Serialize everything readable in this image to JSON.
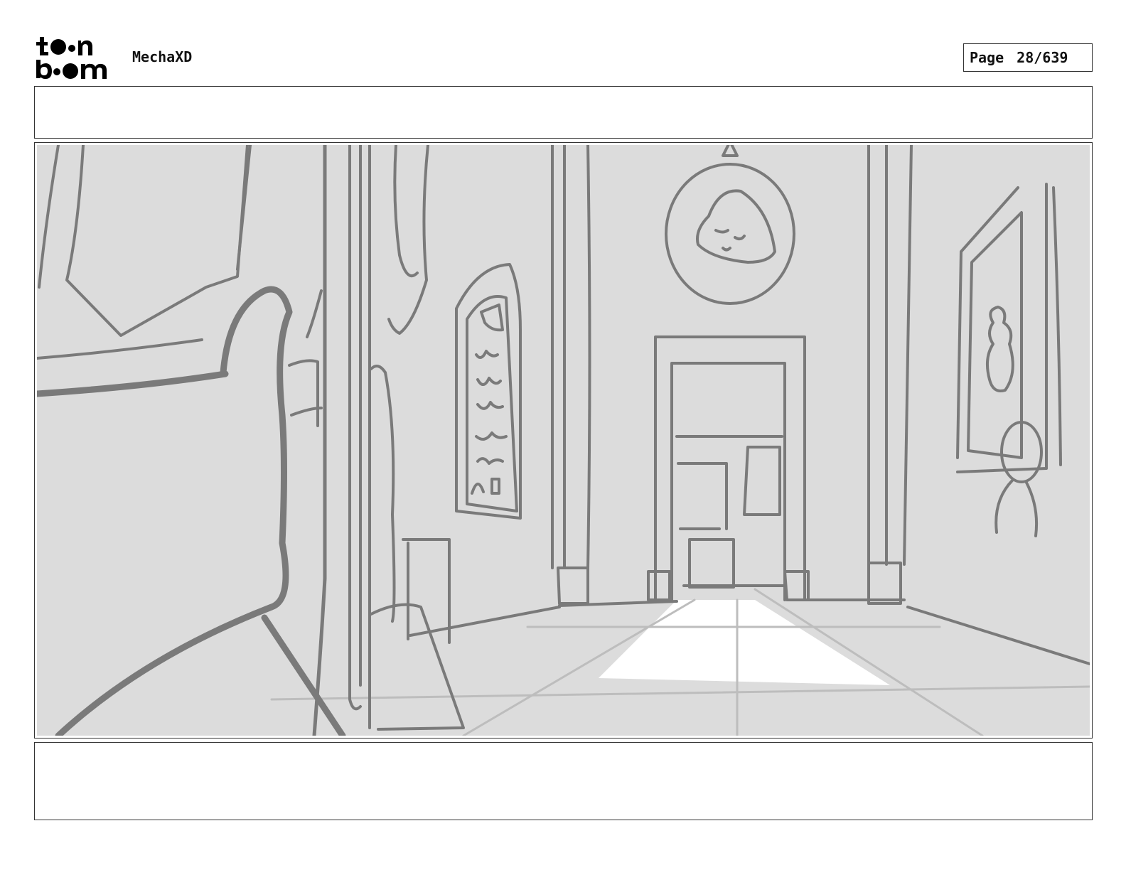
{
  "header": {
    "logo_text": "toon boom",
    "project_title": "MechaXD",
    "page_label": "Page",
    "page_number": "28/639"
  },
  "panel": {
    "dialogue": "",
    "notes": ""
  },
  "colors": {
    "sketch_background": "#dcdcdc",
    "sketch_line": "#7a7a7a",
    "highlight": "#ffffff",
    "guide_line": "#bdbdbd"
  }
}
